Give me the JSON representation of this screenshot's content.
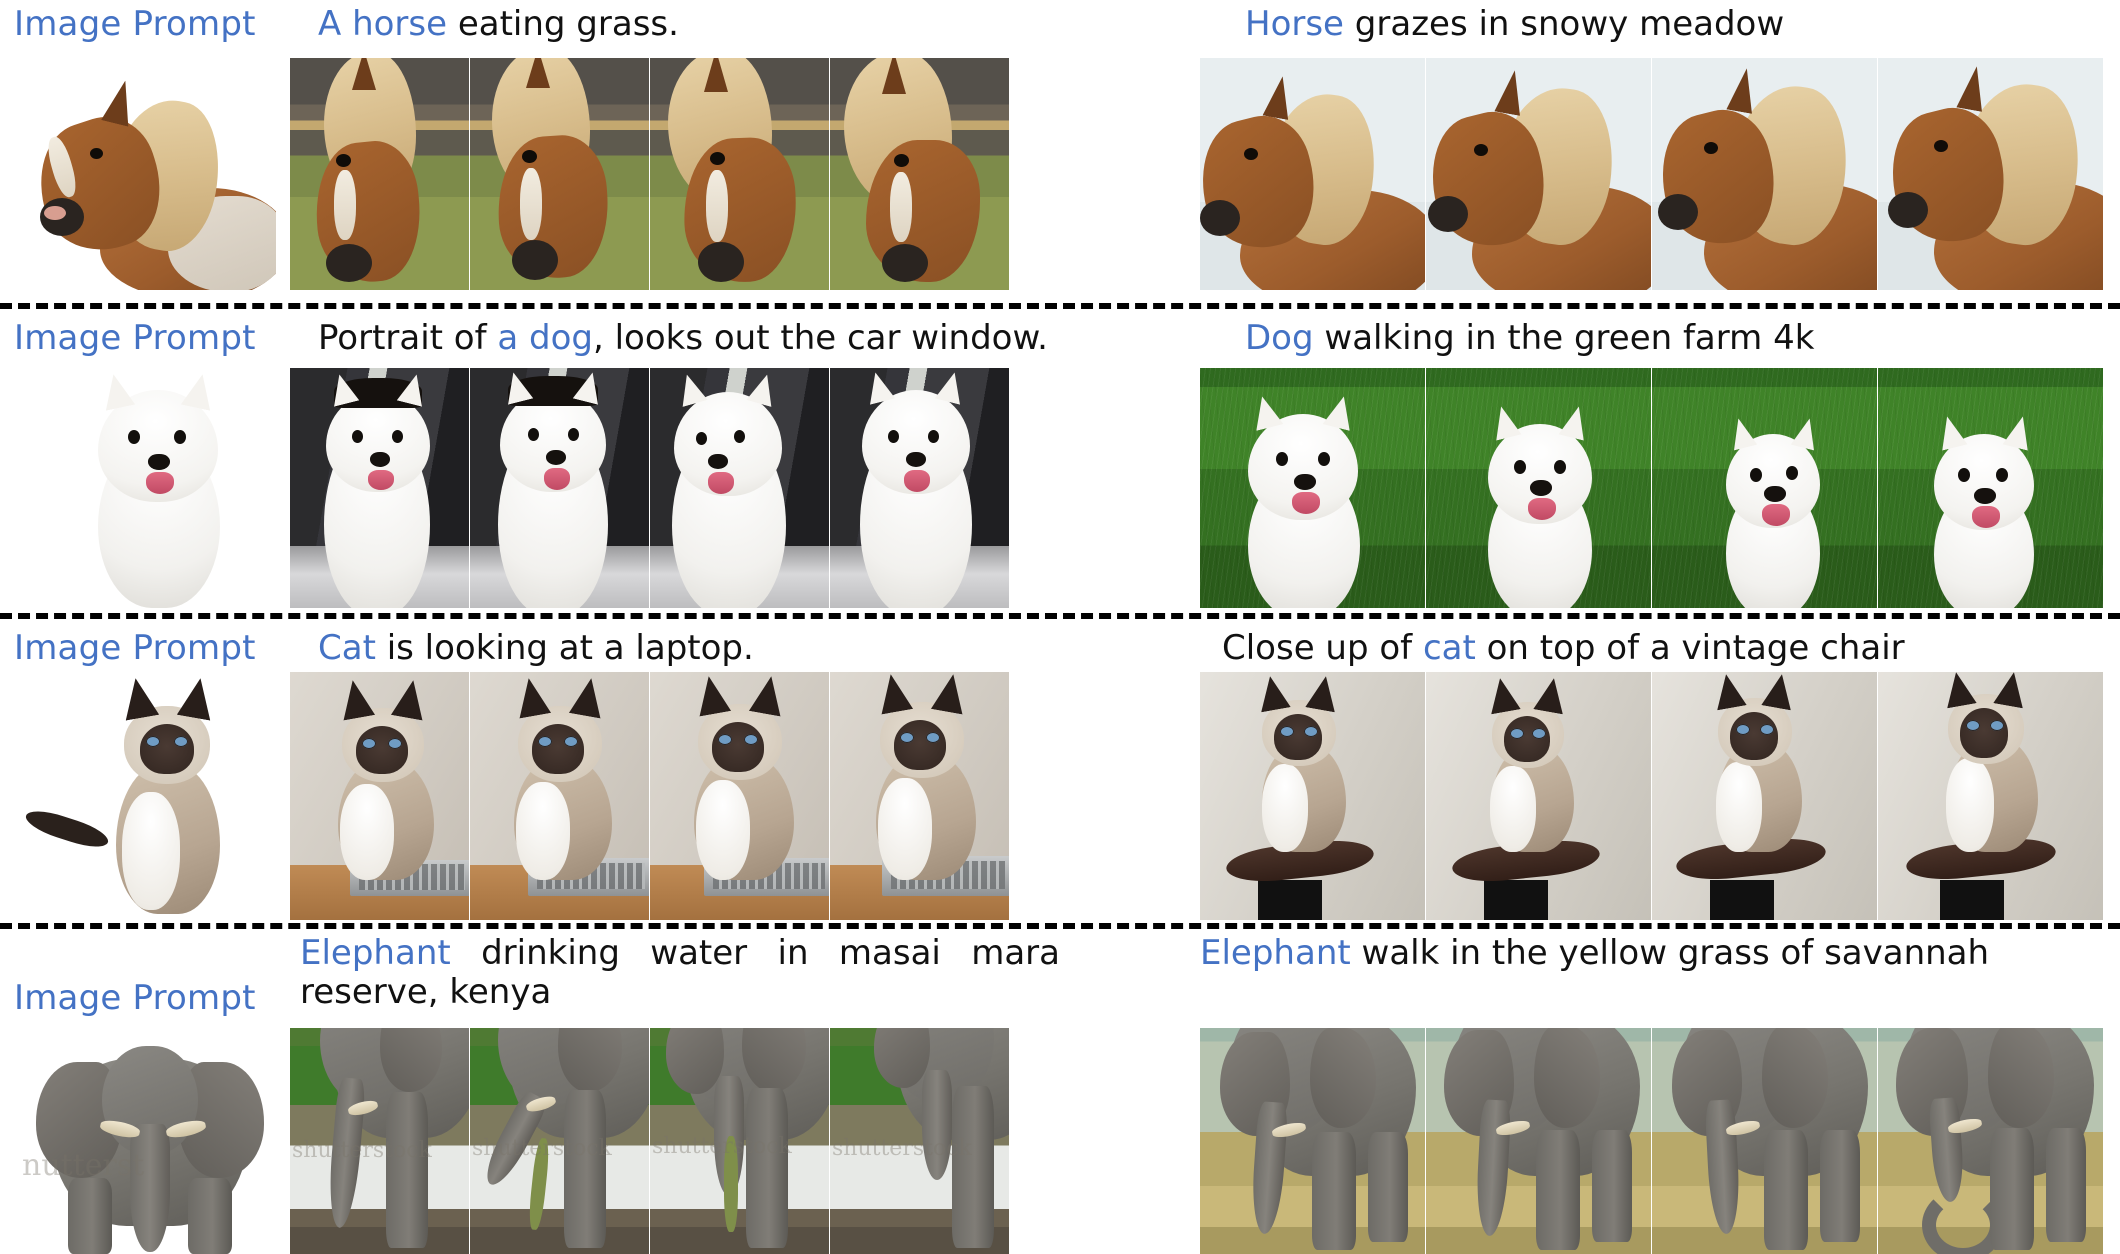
{
  "figure": {
    "type": "image-to-video-qualitative-grid",
    "background": "#ffffff",
    "highlight_color": "#4472c4",
    "text_color": "#111111",
    "separator_style": "dashed-black",
    "frames_per_clip": 4
  },
  "labels": {
    "image_prompt": "Image Prompt"
  },
  "rows": [
    {
      "subject": "horse",
      "reference_label": "Image Prompt",
      "left_clip": {
        "prompt_prefix": "A horse",
        "prompt_rest": " eating grass.",
        "full_prompt": "A horse eating grass.",
        "scene": "horse-field",
        "frames": 4
      },
      "right_clip": {
        "prompt_prefix": "Horse",
        "prompt_rest": " grazes in snowy meadow",
        "full_prompt": "Horse grazes in snowy meadow",
        "scene": "horse-snow",
        "frames": 4
      }
    },
    {
      "subject": "dog",
      "reference_label": "Image Prompt",
      "left_clip": {
        "prompt_pre": "Portrait of ",
        "prompt_prefix": "a dog",
        "prompt_rest": ", looks out the car window.",
        "full_prompt": "Portrait of a dog, looks out the car window.",
        "scene": "car-window",
        "frames": 4
      },
      "right_clip": {
        "prompt_prefix": "Dog",
        "prompt_rest": " walking in the green farm 4k",
        "full_prompt": "Dog walking in the green farm 4k",
        "scene": "green-farm",
        "frames": 4
      }
    },
    {
      "subject": "cat",
      "reference_label": "Image Prompt",
      "left_clip": {
        "prompt_prefix": "Cat",
        "prompt_rest": " is looking at a laptop.",
        "full_prompt": "Cat is looking at a laptop.",
        "scene": "laptop-desk",
        "frames": 4
      },
      "right_clip": {
        "prompt_pre": "Close up of ",
        "prompt_prefix": "cat",
        "prompt_rest": " on top of a vintage chair",
        "full_prompt": "Close up of cat on top of a vintage chair",
        "scene": "vintage-chair",
        "frames": 4
      }
    },
    {
      "subject": "elephant",
      "reference_label": "Image Prompt",
      "left_clip": {
        "prompt_prefix": "Elephant",
        "prompt_rest": " drinking water in masai mara reserve, kenya",
        "full_prompt": "Elephant drinking water in masai mara reserve, kenya",
        "scene": "river-masai-mara",
        "frames": 4
      },
      "right_clip": {
        "prompt_prefix": "Elephant",
        "prompt_rest": " walk in the yellow grass of savannah",
        "full_prompt": "Elephant walk in the yellow grass of savannah",
        "scene": "yellow-savannah",
        "frames": 4
      }
    }
  ],
  "watermarks": {
    "elephant_reference": "nutterst",
    "elephant_frames": "shutterstock"
  }
}
